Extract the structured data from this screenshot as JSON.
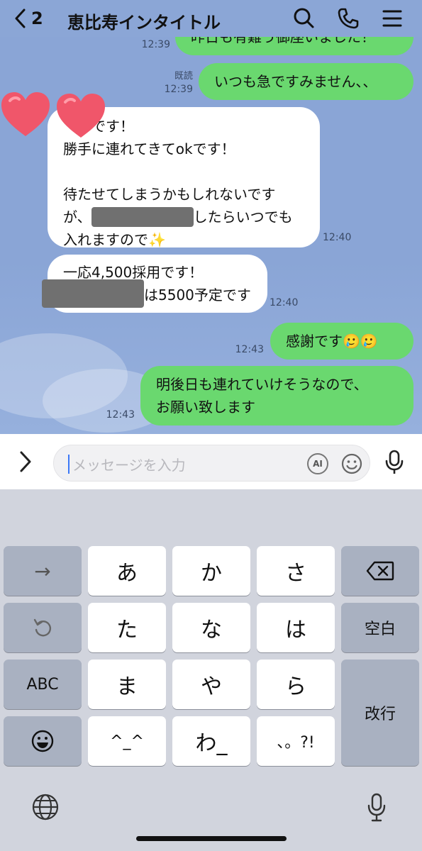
{
  "header": {
    "back_count": "2",
    "title": "恵比寿インタイトル",
    "icons": [
      "chevron-left-icon",
      "search-icon",
      "phone-icon",
      "menu-icon"
    ]
  },
  "messages": [
    {
      "side": "out",
      "text": "昨日も有難う御座いました！",
      "time": "12:39",
      "read": ""
    },
    {
      "side": "out",
      "text": "いつも急ですみません、、",
      "time": "12:39",
      "read": "既読"
    },
    {
      "side": "in",
      "line1": "　　です！",
      "line2": "勝手に連れてきてokです！",
      "line3": "待たせてしまうかもしれないです",
      "line4_pre": "が、",
      "line4_post": "したらいつでも",
      "line5": "入れますので✨",
      "time": "12:40"
    },
    {
      "side": "in",
      "line1": "一応4,500採用です！",
      "line2_post": "は5500予定です",
      "time": "12:40"
    },
    {
      "side": "out",
      "text": "感謝です🥲🥲",
      "time": "12:43",
      "read": ""
    },
    {
      "side": "out",
      "line1": "明後日も連れていけそうなので、",
      "line2": "お願い致します",
      "time": "12:43",
      "read": ""
    }
  ],
  "input": {
    "placeholder": "メッセージを入力",
    "ai_label": "AI"
  },
  "keyboard": {
    "row1": [
      "→",
      "あ",
      "か",
      "さ",
      "⌫"
    ],
    "row2": [
      "↺",
      "た",
      "な",
      "は",
      "空白"
    ],
    "row3": [
      "ABC",
      "ま",
      "や",
      "ら",
      "改行"
    ],
    "row4": [
      "☺",
      "^_^",
      "わ_",
      "、。?!"
    ]
  },
  "colors": {
    "chat_bg": "#8ba6d6",
    "out_bubble": "#6ad86f",
    "in_bubble": "#ffffff",
    "heart": "#f0566a",
    "keyboard_bg": "#d1d4dd"
  }
}
